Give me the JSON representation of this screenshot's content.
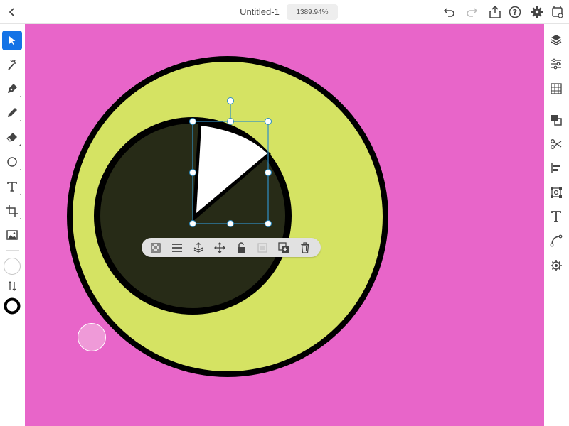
{
  "header": {
    "document_title": "Untitled-1",
    "zoom_level": "1389.94%"
  },
  "left_toolbar": {
    "tools": [
      "select-tool",
      "magic-touch-tool",
      "pen-tool",
      "pencil-tool",
      "eraser-tool",
      "shape-tool",
      "type-tool",
      "crop-tool",
      "image-tool"
    ],
    "active_tool": "select-tool"
  },
  "right_toolbar": {
    "panels": [
      "layers-panel",
      "properties-panel",
      "swatches-panel",
      "combine-shapes",
      "cut",
      "align",
      "transform",
      "type-panel",
      "paths-panel",
      "shape-settings"
    ]
  },
  "colors": {
    "canvas_background": "#e865c9",
    "outer_circle_fill": "#d5e363",
    "inner_circle_fill": "#272b17",
    "stroke": "#000000",
    "selected_shape_fill": "#ffffff",
    "selection_accent": "#2f8fc6",
    "toolbar_active": "#1473e6"
  },
  "context_toolbar": {
    "actions": [
      "transparency",
      "stroke-weight",
      "arrange",
      "move",
      "lock",
      "paste-inside",
      "duplicate",
      "delete"
    ]
  }
}
